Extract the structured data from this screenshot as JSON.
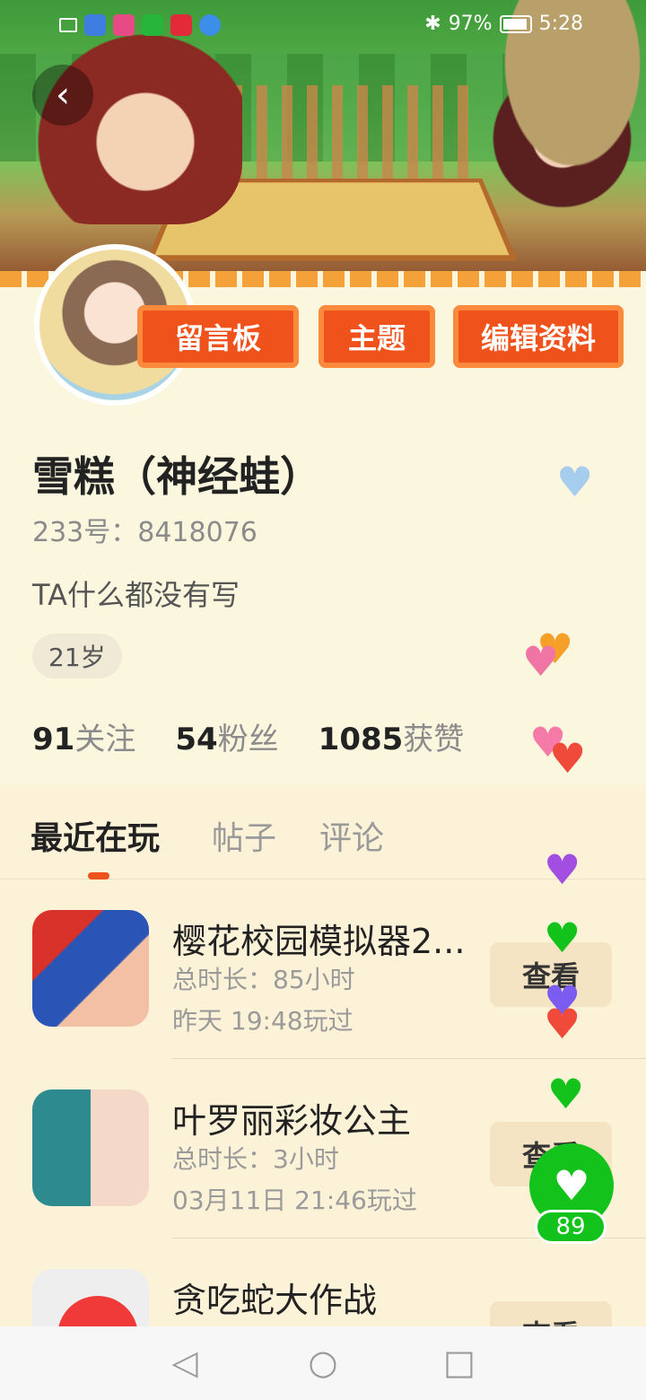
{
  "status_bar": {
    "battery": "97%",
    "time": "5:28"
  },
  "profile": {
    "buttons": {
      "message_board": "留言板",
      "theme": "主题",
      "edit_profile": "编辑资料"
    },
    "name": "雪糕（神经蛙）",
    "id_line": "233号：8418076",
    "bio": "TA什么都没有写",
    "age": "21岁",
    "stats": [
      {
        "value": "91",
        "label": "关注"
      },
      {
        "value": "54",
        "label": "粉丝"
      },
      {
        "value": "1085",
        "label": "获赞"
      }
    ]
  },
  "tabs": [
    "最近在玩",
    "帖子",
    "评论"
  ],
  "games": [
    {
      "title": "樱花校园模拟器2...",
      "duration": "总时长：85小时",
      "last_played": "昨天 19:48玩过",
      "action": "查看"
    },
    {
      "title": "叶罗丽彩妆公主",
      "duration": "总时长：3小时",
      "last_played": "03月11日 21:46玩过",
      "action": "查看"
    },
    {
      "title": "贪吃蛇大作战",
      "duration": "",
      "last_played": "",
      "action": "查看"
    }
  ],
  "like": {
    "count": "89"
  },
  "colors": {
    "accent": "#f0521b",
    "like_green": "#13c21a",
    "background": "#fbf7df"
  }
}
